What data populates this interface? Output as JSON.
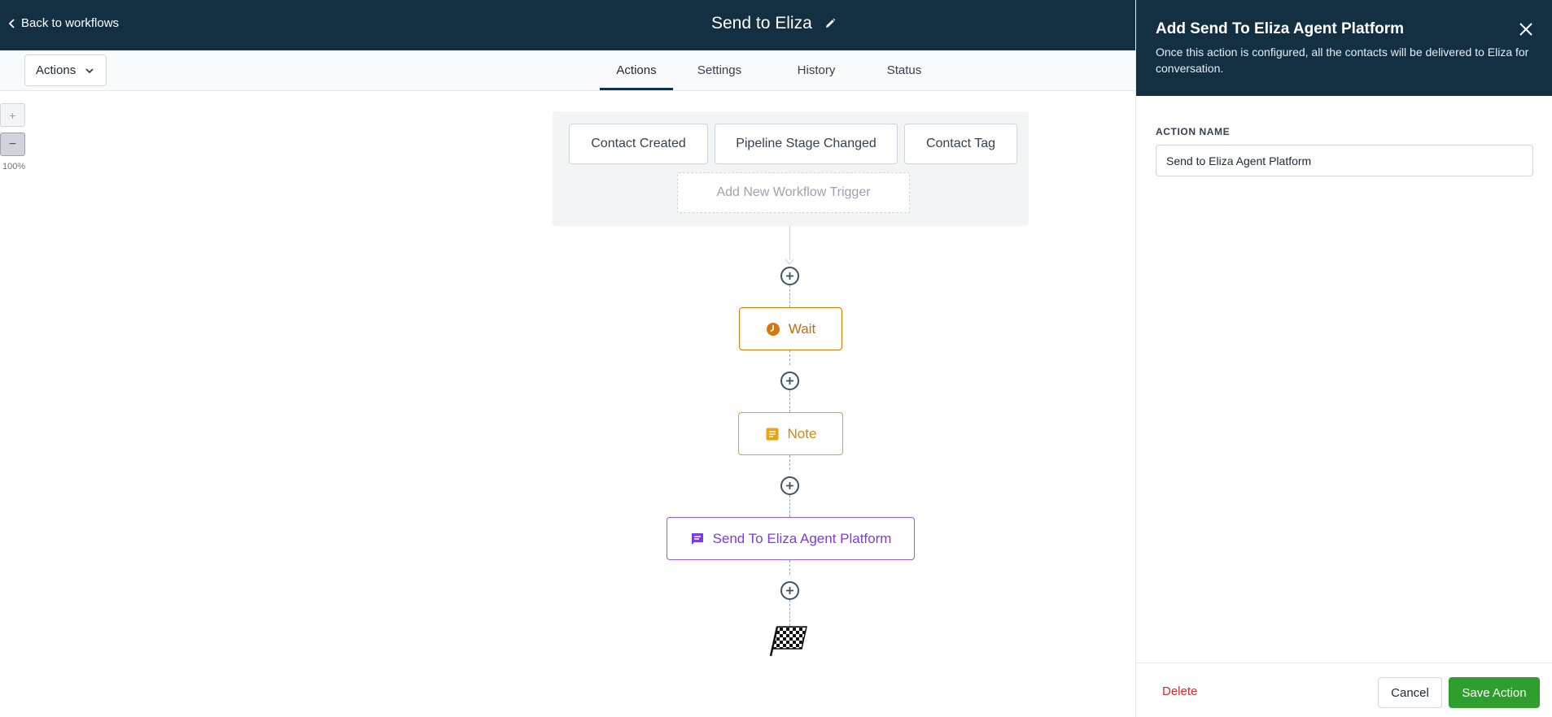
{
  "header": {
    "back_label": "Back to workflows",
    "workflow_title": "Send to Eliza"
  },
  "toolbar": {
    "actions_label": "Actions",
    "tabs": [
      {
        "label": "Actions",
        "active": true
      },
      {
        "label": "Settings",
        "active": false
      },
      {
        "label": "History",
        "active": false
      },
      {
        "label": "Status",
        "active": false
      }
    ]
  },
  "zoom": {
    "in_label": "+",
    "out_label": "−",
    "level": "100%"
  },
  "triggers": {
    "chips": [
      "Contact Created",
      "Pipeline Stage Changed",
      "Contact Tag"
    ],
    "add_label": "Add New Workflow Trigger"
  },
  "flow": {
    "nodes": [
      {
        "label": "Wait",
        "icon": "clock-icon",
        "color": "#d97706"
      },
      {
        "label": "Note",
        "icon": "note-icon",
        "color": "#f59e0b"
      },
      {
        "label": "Send To Eliza Agent Platform",
        "icon": "message-icon",
        "color": "#8b5cf6"
      }
    ],
    "end_icon": "checkered-flag-icon"
  },
  "panel": {
    "title": "Add Send To Eliza Agent Platform",
    "description": "Once this action is configured, all the contacts will be delivered to Eliza for conversation.",
    "field_label": "ACTION NAME",
    "field_value": "Send to Eliza Agent Platform",
    "delete_label": "Delete",
    "cancel_label": "Cancel",
    "save_label": "Save Action"
  },
  "colors": {
    "header_bg": "#133043",
    "save_green": "#2f9e2f",
    "delete_red": "#dc2626"
  }
}
